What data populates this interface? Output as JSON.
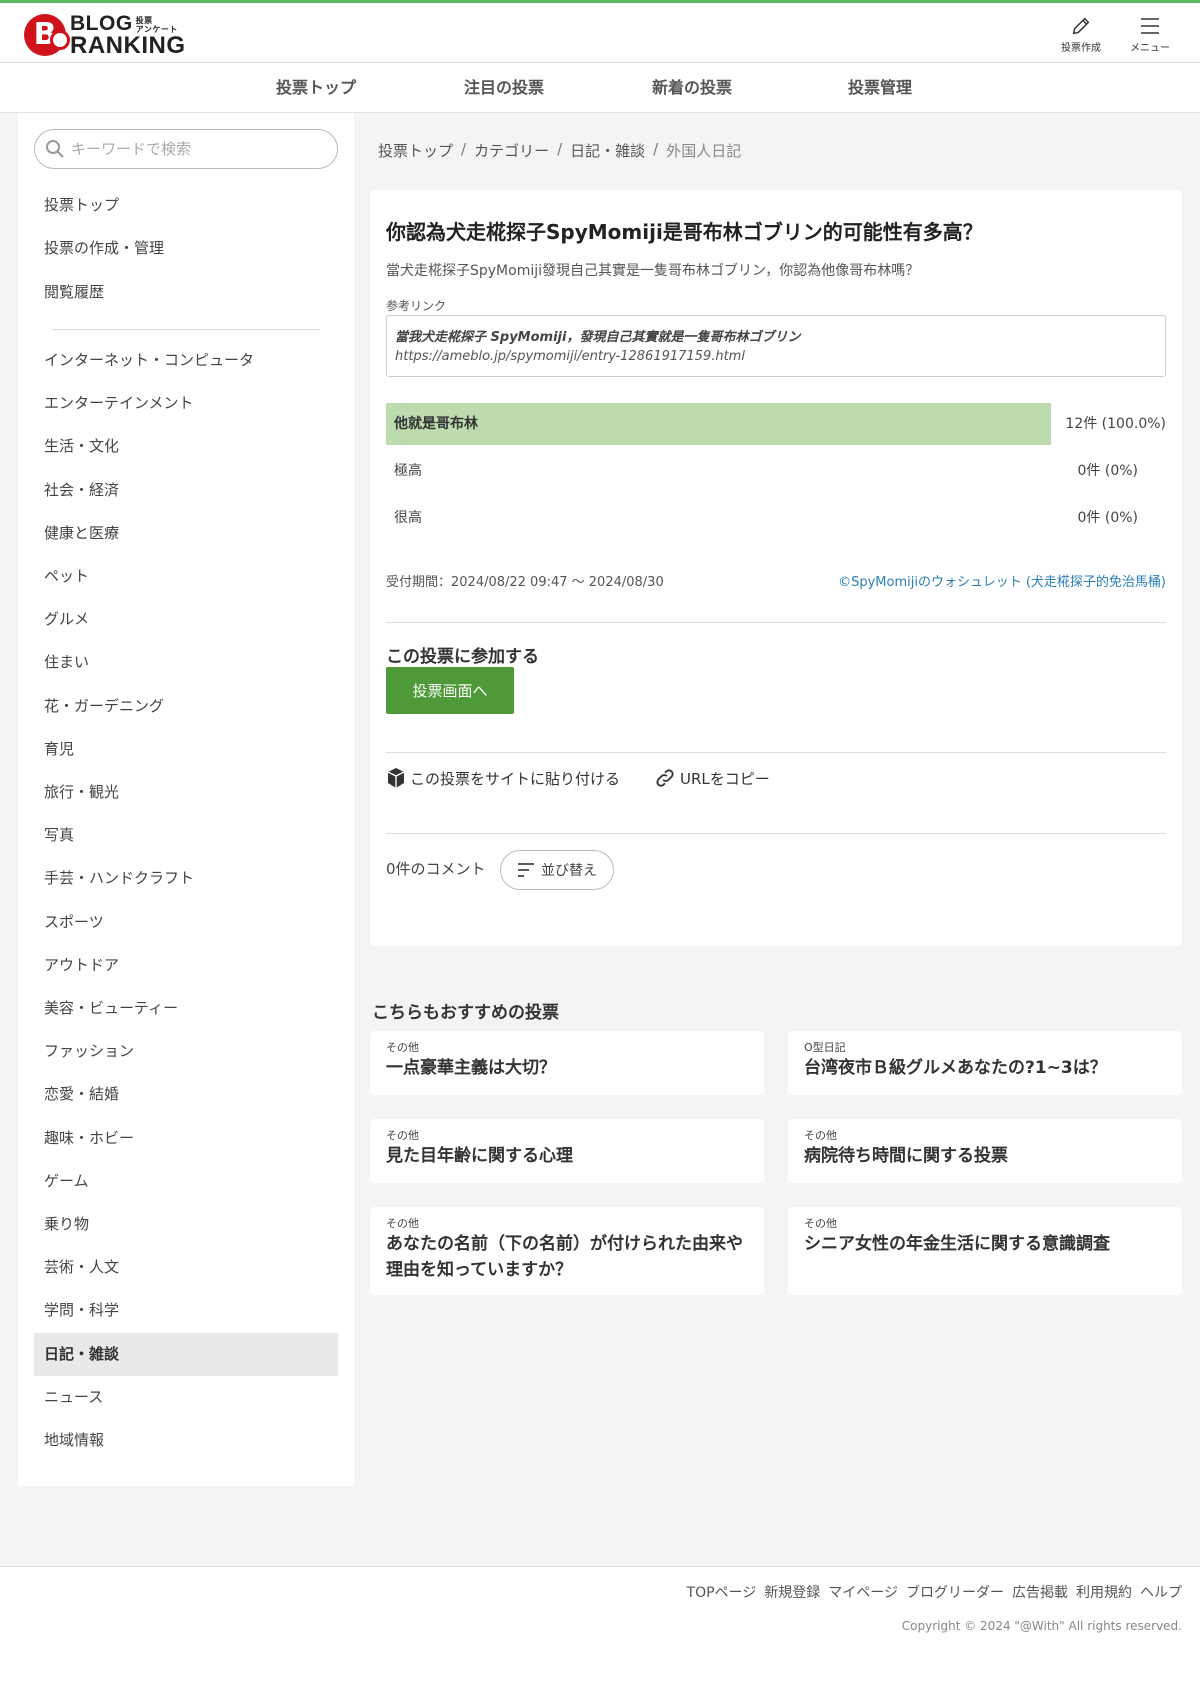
{
  "header": {
    "logo_line1": "BLOG",
    "logo_sub1": "投票",
    "logo_sub2": "アンケート",
    "logo_line2": "RANKING",
    "create_label": "投票作成",
    "menu_label": "メニュー"
  },
  "nav": {
    "items": [
      "投票トップ",
      "注目の投票",
      "新着の投票",
      "投票管理"
    ]
  },
  "search": {
    "placeholder": "キーワードで検索"
  },
  "sidebar": {
    "top_items": [
      "投票トップ",
      "投票の作成・管理",
      "閲覧履歴"
    ],
    "categories": [
      "インターネット・コンピュータ",
      "エンターテインメント",
      "生活・文化",
      "社会・経済",
      "健康と医療",
      "ペット",
      "グルメ",
      "住まい",
      "花・ガーデニング",
      "育児",
      "旅行・観光",
      "写真",
      "手芸・ハンドクラフト",
      "スポーツ",
      "アウトドア",
      "美容・ビューティー",
      "ファッション",
      "恋愛・結婚",
      "趣味・ホビー",
      "ゲーム",
      "乗り物",
      "芸術・人文",
      "学問・科学",
      "日記・雑談",
      "ニュース",
      "地域情報"
    ],
    "active_category": "日記・雑談"
  },
  "breadcrumb": [
    "投票トップ",
    "カテゴリー",
    "日記・雑談",
    "外国人日記"
  ],
  "question": {
    "title": "你認為犬走椛探子SpyMomiji是哥布林ゴブリン的可能性有多高？",
    "description": "當犬走椛探子SpyMomiji發現自己其實是一隻哥布林ゴブリン，你認為他像哥布林嗎？",
    "ref_label": "参考リンク",
    "ref_title": "當我犬走椛探子 SpyMomiji，發現自己其實就是一隻哥布林ゴブリン",
    "ref_url": "https://ameblo.jp/spymomiji/entry-12861917159.html"
  },
  "options": [
    {
      "label": "他就是哥布林",
      "count": "12件 (100.0%)",
      "share": 1.0
    },
    {
      "label": "極高",
      "count": "0件 (0%)",
      "share": 0
    },
    {
      "label": "很高",
      "count": "0件 (0%)",
      "share": 0
    }
  ],
  "period": "受付期間：2024/08/22 09:47 〜 2024/08/30",
  "credit": "©SpyMomijiのウォシュレット (犬走椛探子的免治馬桶)",
  "join": {
    "title": "この投票に参加する",
    "button": "投票画面へ"
  },
  "share": {
    "embed": "この投票をサイトに貼り付ける",
    "copy_url": "URLをコピー"
  },
  "comments": {
    "count": "0件のコメント",
    "sort": "並び替え"
  },
  "recommend": {
    "title": "こちらもおすすめの投票",
    "items": [
      {
        "category": "その他",
        "title": "一点豪華主義は大切？"
      },
      {
        "category": "O型日記",
        "title": "台湾夜市Ｂ級グルメあなたの?1~3は？"
      },
      {
        "category": "その他",
        "title": "見た目年齢に関する心理"
      },
      {
        "category": "その他",
        "title": "病院待ち時間に関する投票"
      },
      {
        "category": "その他",
        "title": "あなたの名前（下の名前）が付けられた由来や理由を知っていますか？"
      },
      {
        "category": "その他",
        "title": "シニア女性の年金生活に関する意識調査"
      }
    ]
  },
  "footer": {
    "links": [
      "TOPページ",
      "新規登録",
      "マイページ",
      "ブログリーダー",
      "広告掲載",
      "利用規約",
      "ヘルプ"
    ],
    "copyright": "Copyright © 2024 \"@With\" All rights reserved."
  },
  "colors": {
    "accent_green": "#4f9a38",
    "bar_green": "#bcdcb0",
    "link_blue": "#2a7fb8",
    "top_line": "#5cb85c"
  }
}
